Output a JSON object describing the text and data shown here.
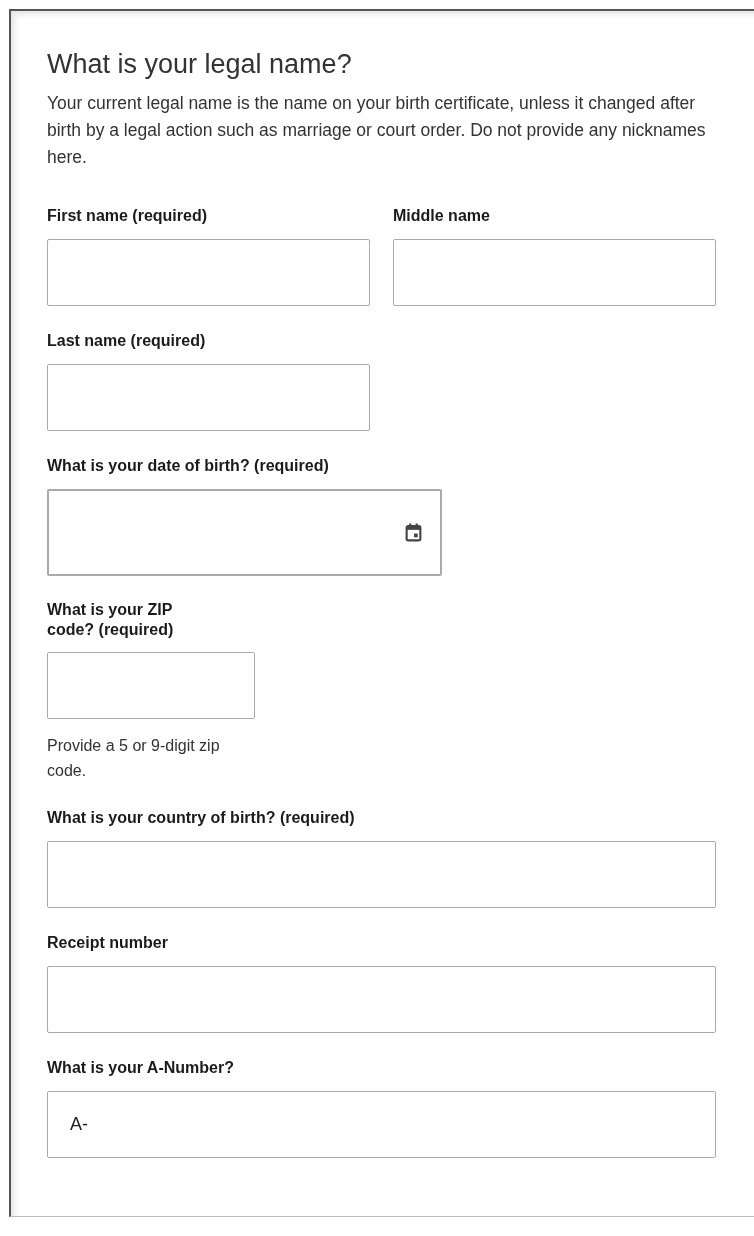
{
  "heading": "What is your legal name?",
  "intro": "Your current legal name is the name on your birth certificate, unless it changed after birth by a legal action such as marriage or court order. Do not provide any nicknames here.",
  "rows": [
    {
      "fields": [
        {
          "label": "First name (required)",
          "kind": "text"
        },
        {
          "label": "Middle name",
          "kind": "text"
        }
      ]
    },
    {
      "fields": [
        {
          "label": "Last name (required)",
          "kind": "text"
        }
      ]
    },
    {
      "fields": [
        {
          "label": "What is your date of birth? (required)",
          "kind": "date"
        }
      ]
    },
    {
      "fields": [
        {
          "label": "What is your ZIP code? (required)",
          "kind": "text",
          "help": "Provide a 5 or 9-digit zip code."
        }
      ]
    },
    {
      "fields": [
        {
          "label": "What is your country of birth? (required)",
          "kind": "text"
        }
      ]
    },
    {
      "fields": [
        {
          "label": "Receipt number",
          "kind": "text"
        }
      ]
    },
    {
      "fields": [
        {
          "label": "What is your A-Number?",
          "kind": "text",
          "value": "A-"
        }
      ]
    }
  ]
}
